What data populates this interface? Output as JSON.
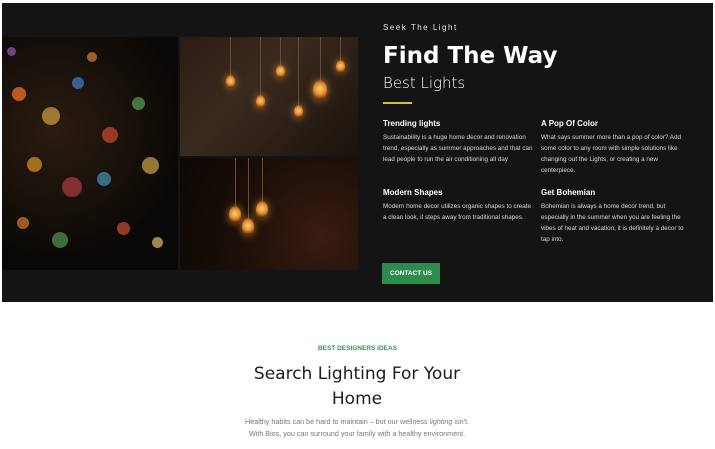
{
  "hero": {
    "eyebrow": "Seek The Light",
    "title": "Find The Way",
    "subtitle": "Best Lights",
    "accent_color": "#c7c43a",
    "features": [
      {
        "title": "Trending lights",
        "text": "Sustainability is a huge home decor and renovation trend, especially as summer approaches and that can lead people to run the air conditioning all day"
      },
      {
        "title": "A Pop Of Color",
        "text": "What says summer more than a pop of color? Add some color to any room with simple solutions like changing out the Lights, or creating a new centerpiece."
      },
      {
        "title": "Modern Shapes",
        "text": "Modern home decor utilizes organic shapes to create a clean look, it steps away from traditional shapes."
      },
      {
        "title": "Get Bohemian",
        "text": "Bohemian is always a home decor trend, but especially in the summer when you are feeling the vibes of heat and vacation, it is definitely a decor to tap into."
      }
    ],
    "cta_label": "CONTACT US",
    "cta_color": "#2e8b4e"
  },
  "section": {
    "eyebrow": "BEST DESIGNERS IDEAS",
    "title": "Search Lighting For Your Home",
    "text_before": "Healthy habits can be hard to maintain – but our wellness ",
    "text_em": "lighting",
    "text_after": " isn't. With Bios, you can surround your family with a healthy environment."
  }
}
